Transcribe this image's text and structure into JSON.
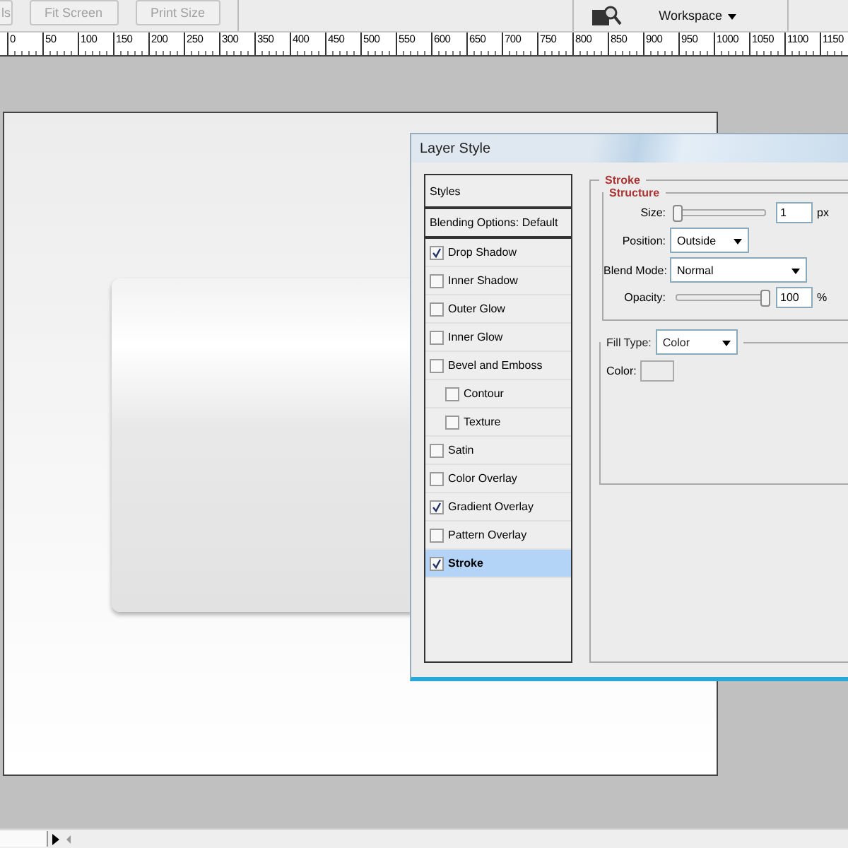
{
  "toolbar": {
    "buttons": [
      {
        "label": "ls"
      },
      {
        "label": "Fit Screen"
      },
      {
        "label": "Print Size"
      }
    ],
    "workspace": "Workspace"
  },
  "ruler": {
    "ticks": [
      "0",
      "50",
      "100",
      "150",
      "200",
      "250",
      "300",
      "350",
      "400",
      "450",
      "500",
      "550",
      "600",
      "650",
      "700",
      "750",
      "800",
      "850",
      "900",
      "950",
      "1000",
      "1050",
      "1100",
      "1150"
    ]
  },
  "dialog": {
    "title": "Layer Style",
    "styles_header": "Styles",
    "blending_options": "Blending Options: Default",
    "effects": [
      {
        "label": "Drop Shadow",
        "checked": true,
        "selected": false
      },
      {
        "label": "Inner Shadow",
        "checked": false,
        "selected": false
      },
      {
        "label": "Outer Glow",
        "checked": false,
        "selected": false
      },
      {
        "label": "Inner Glow",
        "checked": false,
        "selected": false
      },
      {
        "label": "Bevel and Emboss",
        "checked": false,
        "selected": false,
        "children": [
          {
            "label": "Contour",
            "checked": false,
            "selected": false
          },
          {
            "label": "Texture",
            "checked": false,
            "selected": false
          }
        ]
      },
      {
        "label": "Satin",
        "checked": false,
        "selected": false
      },
      {
        "label": "Color Overlay",
        "checked": false,
        "selected": false
      },
      {
        "label": "Gradient Overlay",
        "checked": true,
        "selected": false
      },
      {
        "label": "Pattern Overlay",
        "checked": false,
        "selected": false
      },
      {
        "label": "Stroke",
        "checked": true,
        "selected": true
      }
    ],
    "stroke": {
      "title": "Stroke",
      "structure": {
        "title": "Structure",
        "size": {
          "label": "Size:",
          "level": 0,
          "value": "1",
          "unit": "px"
        },
        "position": {
          "label": "Position:",
          "value": "Outside"
        },
        "blend_mode": {
          "label": "Blend Mode:",
          "value": "Normal"
        },
        "opacity": {
          "label": "Opacity:",
          "level": 1,
          "value": "100",
          "unit": "%"
        }
      },
      "fill_type": {
        "label": "Fill Type:",
        "value": "Color"
      },
      "color": {
        "label": "Color:",
        "color": "#ececec"
      }
    }
  }
}
